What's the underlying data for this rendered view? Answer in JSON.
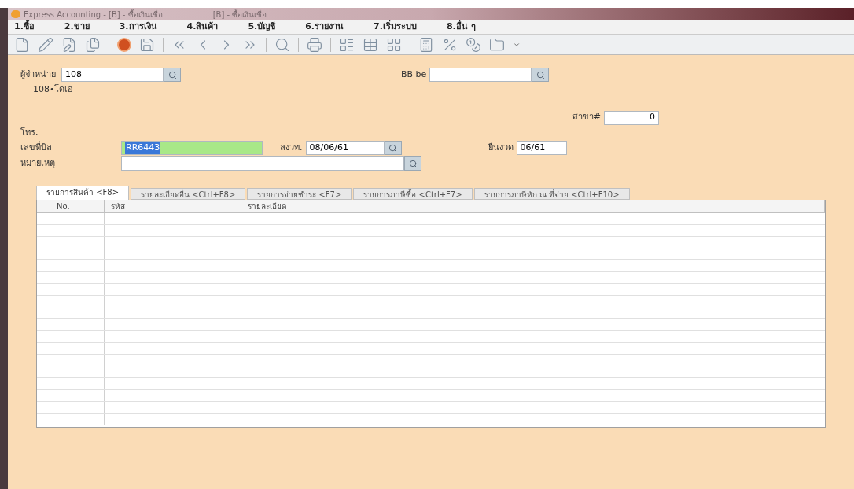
{
  "window": {
    "title": "Express Accounting - [B] - ซื้อเงินเชื่อ",
    "title_2": "[B] - ซื้อเงินเชื่อ"
  },
  "menu": [
    {
      "label": "1.ซื้อ"
    },
    {
      "label": "2.ขาย"
    },
    {
      "label": "3.การเงิน"
    },
    {
      "label": "4.สินค้า"
    },
    {
      "label": "5.บัญชี"
    },
    {
      "label": "6.รายงาน"
    },
    {
      "label": "7.เริ่มระบบ"
    },
    {
      "label": "8.อื่น ๆ"
    }
  ],
  "form": {
    "supplier": {
      "label": "ผู้จำหน่าย",
      "value": "108"
    },
    "supplier_name": "108•โดเอ",
    "bill_be": {
      "label": "BB be"
    },
    "phone_label": "โทร.",
    "branch": {
      "label": "สาขา#",
      "value": "0"
    },
    "bill_no": {
      "label": "เลขที่บิล",
      "value": "RR6443"
    },
    "date": {
      "label": "ลงวท.",
      "value": "08/06/61"
    },
    "period": {
      "label": "ยื่นงวด",
      "value": "06/61"
    },
    "note": {
      "label": "หมายเหตุ"
    }
  },
  "tabs": [
    {
      "label": "รายการสินค้า <F8>",
      "selected": true
    },
    {
      "label": "รายละเอียดอื่น <Ctrl+F8>",
      "selected": false
    },
    {
      "label": "รายการจ่ายชำระ <F7>",
      "selected": false
    },
    {
      "label": "รายการภาษีซื้อ <Ctrl+F7>",
      "selected": false
    },
    {
      "label": "รายการภาษีหัก ณ ที่จ่าย <Ctrl+F10>",
      "selected": false
    }
  ],
  "table": {
    "columns": [
      "No.",
      "รหัส",
      "รายละเอียด"
    ]
  }
}
